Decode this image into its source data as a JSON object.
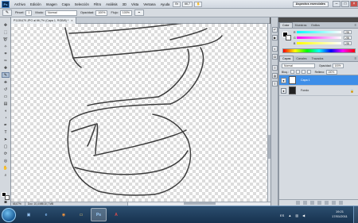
{
  "app": {
    "logo": "Ps"
  },
  "menu": {
    "items": [
      "Archivo",
      "Edición",
      "Imagen",
      "Capa",
      "Selección",
      "Filtro",
      "Análisis",
      "3D",
      "Vista",
      "Ventana",
      "Ayuda"
    ],
    "zoom": "66,7",
    "workspace": "Aspectos esenciales"
  },
  "options": {
    "brush_size": "1",
    "mode_label": "Modo:",
    "mode_value": "Normal",
    "opacity_label": "Opacidad:",
    "opacity_value": "100%",
    "flow_label": "Flujo:",
    "flow_value": "100%"
  },
  "document": {
    "tab_title": "P1130470.JPG al 66,7% (Capa 1, RGB/8) *",
    "zoom": "66,67%",
    "doc_info": "Doc: 10,4 MB/10,7 MB"
  },
  "color_panel": {
    "tabs": [
      "Color",
      "Muestras",
      "Estilos"
    ],
    "channels": [
      {
        "letter": "R",
        "value": "255"
      },
      {
        "letter": "G",
        "value": "255"
      },
      {
        "letter": "B",
        "value": "255"
      }
    ]
  },
  "layers_panel": {
    "tabs": [
      "Capas",
      "Canales",
      "Trazados"
    ],
    "blend_mode": "Normal",
    "opacity_label": "Opacidad:",
    "opacity_value": "100%",
    "lock_label": "Bloq.:",
    "fill_label": "Relleno:",
    "fill_value": "100%",
    "layers": [
      {
        "name": "Capa 1",
        "selected": true
      },
      {
        "name": "Fondo",
        "selected": false
      }
    ]
  },
  "taskbar": {
    "language": "ES",
    "time": "19:21",
    "date": "17/01/2011"
  },
  "colors": {
    "selection": "#3d8ee8",
    "stroke": "#3c3c3c",
    "taskbar": "#1f3d5c"
  }
}
